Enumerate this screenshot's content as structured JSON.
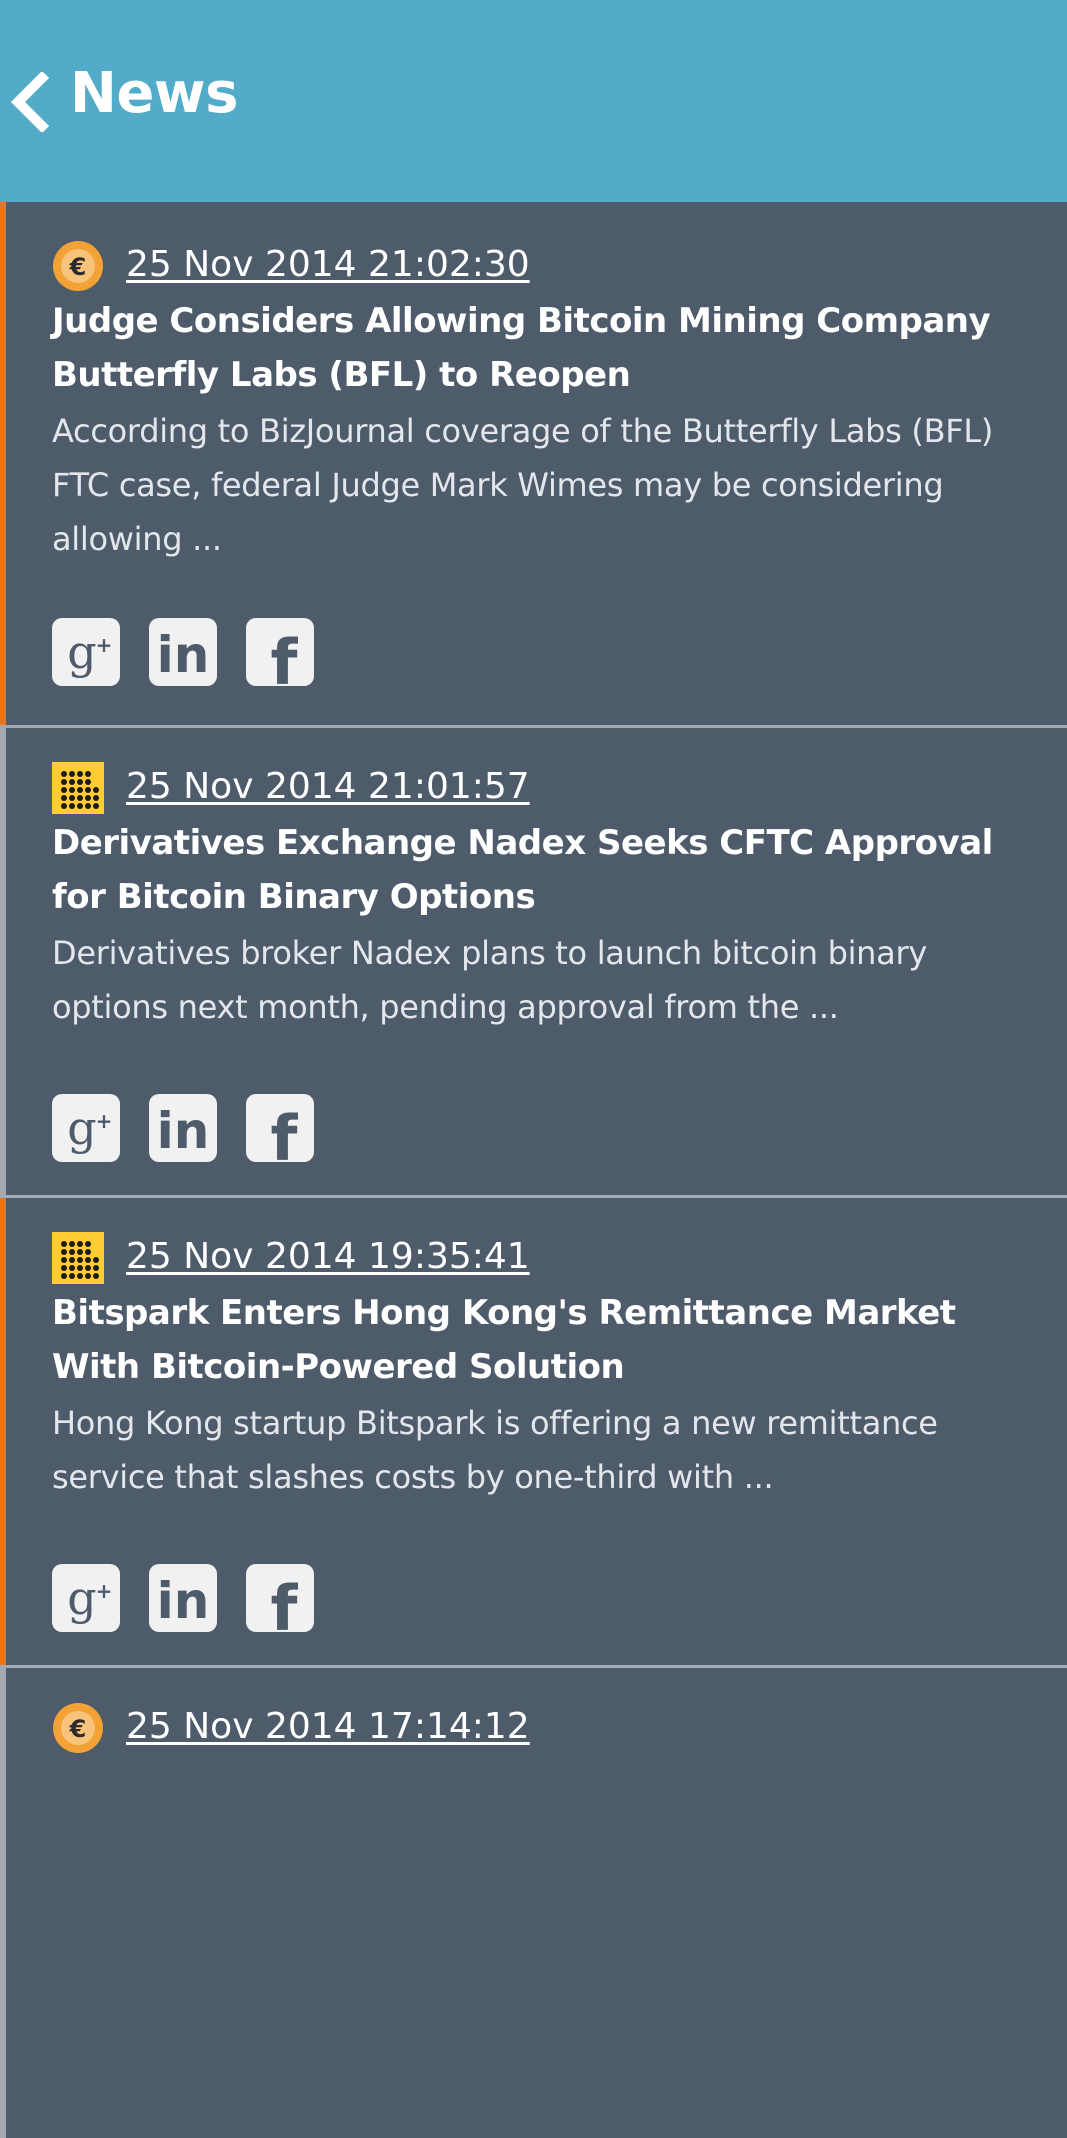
{
  "header": {
    "title": "News",
    "background": "#52abc8"
  },
  "colors": {
    "background": "#4e5b6b",
    "accent_orange": "#e8751f",
    "accent_gray": "#a2a9b2",
    "coin_orange": "#f3a335",
    "grid_yellow": "#ffcc33"
  },
  "news": [
    {
      "date": "25 Nov 2014 21:02:30",
      "title": "Judge Considers Allowing Bitcoin Mining Company Butterfly Labs (BFL) to Reopen",
      "summary": "According to BizJournal coverage of the Butterfly Labs (BFL) FTC case, federal Judge Mark Wimes may be considering allowing ...",
      "source_icon": "coin-icon",
      "accent": "#e8751f"
    },
    {
      "date": "25 Nov 2014 21:01:57",
      "title": "Derivatives Exchange Nadex Seeks CFTC Approval for Bitcoin Binary Options",
      "summary": "Derivatives broker Nadex plans to launch bitcoin binary options next month, pending approval from the ...",
      "source_icon": "dot-grid-icon",
      "accent": "#a2a9b2"
    },
    {
      "date": "25 Nov 2014 19:35:41",
      "title": "Bitspark Enters Hong Kong's Remittance Market With Bitcoin-Powered Solution",
      "summary": "Hong Kong startup Bitspark is offering a new remittance service that slashes costs by one-third with ...",
      "source_icon": "dot-grid-icon",
      "accent": "#e8751f"
    },
    {
      "date": "25 Nov 2014 17:14:12",
      "title": "",
      "summary": "",
      "source_icon": "coin-icon",
      "accent": "#a2a9b2"
    }
  ],
  "share_buttons": [
    "google-plus-icon",
    "linkedin-icon",
    "facebook-icon"
  ]
}
